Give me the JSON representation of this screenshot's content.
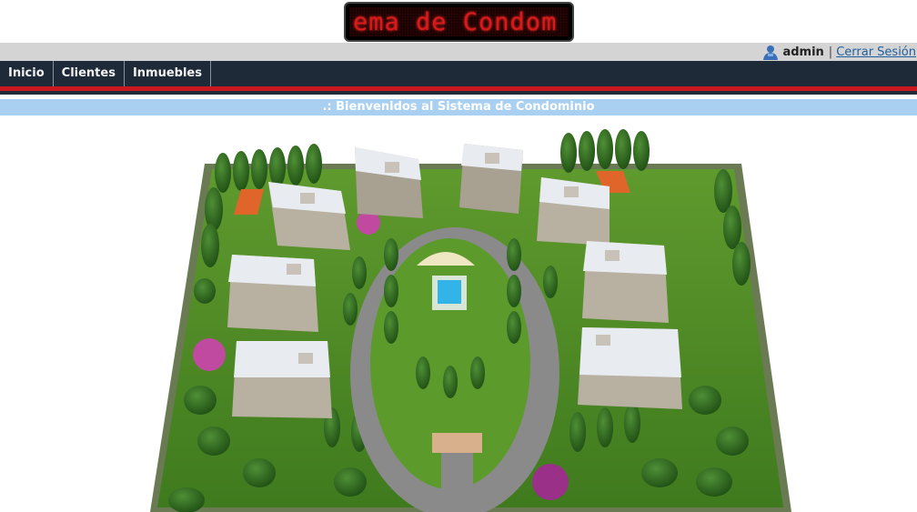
{
  "header": {
    "marquee_text": "ema de Condom"
  },
  "userbar": {
    "username": "admin",
    "separator": "|",
    "logout_label": "Cerrar Sesión",
    "user_icon": "user-icon"
  },
  "nav": {
    "items": [
      {
        "label": "Inicio"
      },
      {
        "label": "Clientes"
      },
      {
        "label": "Inmuebles"
      }
    ]
  },
  "welcome": {
    "text": ".: Bienvenidos al Sistema de Condominio"
  },
  "colors": {
    "navbar": "#1f2a38",
    "accent_red": "#c9191f",
    "welcome_bar": "#a9d0f0",
    "userbar": "#d4d4d4",
    "led_text": "#d81a1a"
  }
}
